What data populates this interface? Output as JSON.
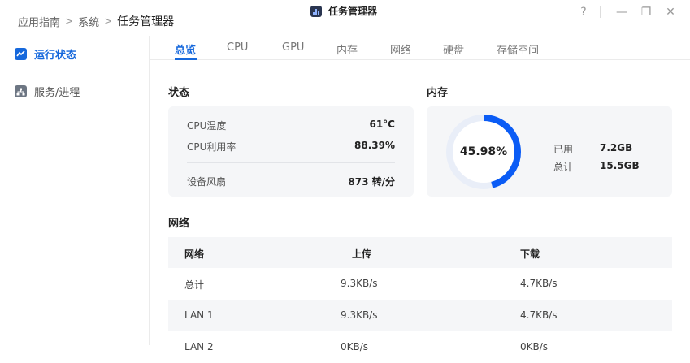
{
  "breadcrumb": {
    "items": [
      "应用指南",
      "系统"
    ],
    "current": "任务管理器"
  },
  "app": {
    "title": "任务管理器"
  },
  "window_controls": {
    "help": "?",
    "minimize": "—",
    "restore": "❐",
    "close": "✕"
  },
  "sidebar": {
    "items": [
      {
        "label": "运行状态",
        "icon": "chart-icon",
        "active": true
      },
      {
        "label": "服务/进程",
        "icon": "sitemap-icon",
        "active": false
      }
    ]
  },
  "tabs": [
    "总览",
    "CPU",
    "GPU",
    "内存",
    "网络",
    "硬盘",
    "存储空间"
  ],
  "status": {
    "title": "状态",
    "cpu_temp_label": "CPU温度",
    "cpu_temp_value": "61°C",
    "cpu_usage_label": "CPU利用率",
    "cpu_usage_value": "88.39%",
    "fan_label": "设备风扇",
    "fan_value": "873 转/分"
  },
  "memory": {
    "title": "内存",
    "percent_text": "45.98%",
    "percent": 45.98,
    "used_label": "已用",
    "used_value": "7.2GB",
    "total_label": "总计",
    "total_value": "15.5GB"
  },
  "network": {
    "title": "网络",
    "columns": [
      "网络",
      "上传",
      "下载"
    ],
    "rows": [
      [
        "总计",
        "9.3KB/s",
        "4.7KB/s"
      ],
      [
        "LAN 1",
        "9.3KB/s",
        "4.7KB/s"
      ],
      [
        "LAN 2",
        "0KB/s",
        "0KB/s"
      ]
    ]
  },
  "colors": {
    "accent": "#1668dc",
    "ring_fill": "#0b5cf5",
    "ring_track": "#e9eef8",
    "card_bg": "#f5f6f8"
  }
}
